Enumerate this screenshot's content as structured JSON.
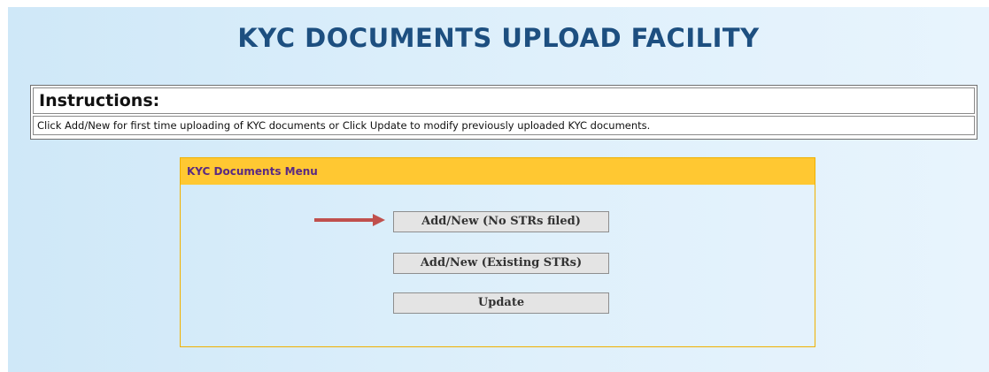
{
  "page": {
    "title": "KYC DOCUMENTS UPLOAD FACILITY"
  },
  "instructions": {
    "heading": "Instructions:",
    "text": "Click Add/New for first time uploading of KYC documents or Click Update to modify previously uploaded KYC documents."
  },
  "menu": {
    "title": "KYC Documents Menu",
    "buttons": [
      {
        "label": "Add/New (No STRs filed)"
      },
      {
        "label": "Add/New (Existing STRs)"
      },
      {
        "label": "Update"
      }
    ]
  },
  "colors": {
    "title": "#1d4f80",
    "menu_header_bg": "#ffc832",
    "menu_header_text": "#5a2a82",
    "arrow": "#c0504d",
    "background": "#dceefb"
  },
  "icons": {
    "pointer": "arrow-right-icon"
  }
}
